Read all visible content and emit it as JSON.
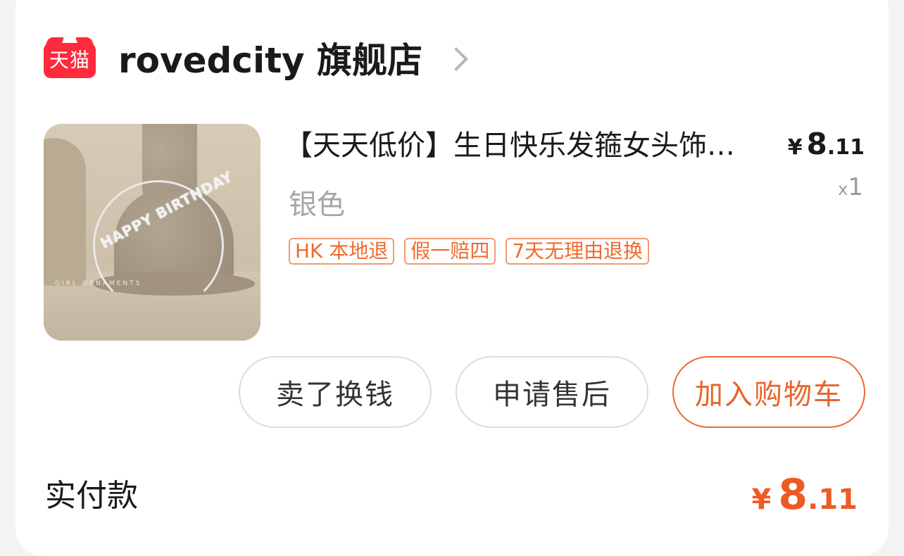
{
  "store": {
    "badge": "天猫",
    "name": "rovedcity 旗舰店"
  },
  "product": {
    "title": "【天天低价】生日快乐发箍女头饰生日派对装饰",
    "variant": "银色",
    "price_currency": "¥",
    "price_int": "8",
    "price_dec": ".11",
    "qty_prefix": "x",
    "qty": "1",
    "image_text_main": "HAPPY BIRTHDAY",
    "image_text_sub": "GIRL ORNAMENTS",
    "tags": [
      "HK 本地退",
      "假一赔四",
      "7天无理由退换"
    ]
  },
  "actions": {
    "sell": "卖了换钱",
    "after_sale": "申请售后",
    "add_cart": "加入购物车"
  },
  "payment": {
    "label": "实付款",
    "currency": "¥",
    "amount_int": "8",
    "amount_dec": ".11"
  },
  "colors": {
    "accent": "#ee5a24",
    "tag_border": "#f29a73",
    "tmall_red": "#ff2a3c"
  }
}
